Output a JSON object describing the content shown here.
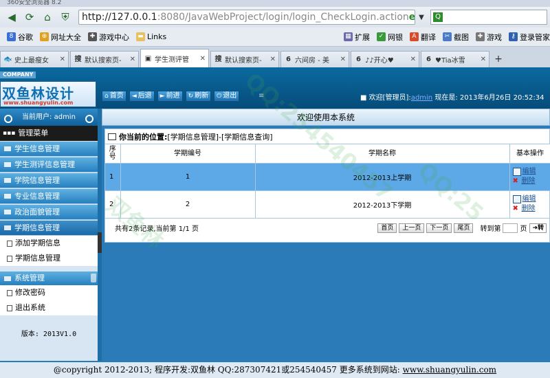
{
  "browser": {
    "window_title": "360安全浏览器 8.2",
    "url_host": "http://127.0.0.1",
    "url_path": ":8080/JavaWebProject/login/login_CheckLogin.action",
    "bookmarks": [
      "谷歌",
      "网址大全",
      "游戏中心",
      "Links"
    ],
    "bookmark_tools": [
      "扩展",
      "网银",
      "翻译",
      "截图",
      "游戏",
      "登录管家"
    ],
    "tabs": [
      {
        "label": "史上最瘦女",
        "icon": "🐟",
        "active": false
      },
      {
        "label": "默认搜索页-",
        "icon": "搜",
        "active": false
      },
      {
        "label": "学生测评管",
        "icon": "▣",
        "active": true
      },
      {
        "label": "默认搜索页-",
        "icon": "搜",
        "active": false
      },
      {
        "label": "六间房 - 美",
        "icon": "6",
        "active": false
      },
      {
        "label": "♪♪开心♥",
        "icon": "6",
        "active": false
      },
      {
        "label": "♥Tia冰雪",
        "icon": "6",
        "active": false
      }
    ]
  },
  "header": {
    "company": "COMPANY",
    "logo_text": "双鱼林设计",
    "logo_url": "www.shuangyulin.com",
    "toolbar": [
      {
        "icon": "⌂",
        "label": "首页"
      },
      {
        "icon": "◄",
        "label": "后退"
      },
      {
        "icon": "►",
        "label": "前进"
      },
      {
        "icon": "↻",
        "label": "刷新"
      },
      {
        "icon": "⏻",
        "label": "退出"
      }
    ],
    "welcome_prefix": "■ 欢迎[管理员]:",
    "welcome_user": "admin",
    "welcome_suffix": " 现在是: 2013年6月26日 20:52:34"
  },
  "sidebar": {
    "current_user": "当前用户: admin",
    "menu_title": "管理菜单",
    "items": [
      "学生信息管理",
      "学生测评信息管理",
      "学院信息管理",
      "专业信息管理",
      "政治面貌管理",
      "学期信息管理"
    ],
    "sub_items": [
      "添加学期信息",
      "学期信息管理"
    ],
    "system_title": "系统管理",
    "system_items": [
      "修改密码",
      "退出系统"
    ],
    "version": "版本: 2013V1.0"
  },
  "main": {
    "title": "欢迎使用本系统",
    "location_label": "你当前的位置:",
    "location_path": "[学期信息管理]-[学期信息查询]",
    "columns": [
      "序号",
      "学期编号",
      "学期名称",
      "基本操作"
    ],
    "rows": [
      {
        "no": "1",
        "id": "1",
        "name": "2012-2013上学期"
      },
      {
        "no": "2",
        "id": "2",
        "name": "2012-2013下学期"
      }
    ],
    "edit_label": "编辑",
    "delete_label": "删除",
    "pager": {
      "summary": "共有2条记录,当前第 1/1 页",
      "first": "首页",
      "prev": "上一页",
      "next": "下一页",
      "last": "尾页",
      "goto_label": "转到第",
      "page_unit": "页",
      "go": "➜转"
    }
  },
  "footer": {
    "text": "@copyright 2012-2013; 程序开发:双鱼林 QQ:287307421或254540457 更多系统到网站: ",
    "site": "www.shuangyulin.com"
  }
}
